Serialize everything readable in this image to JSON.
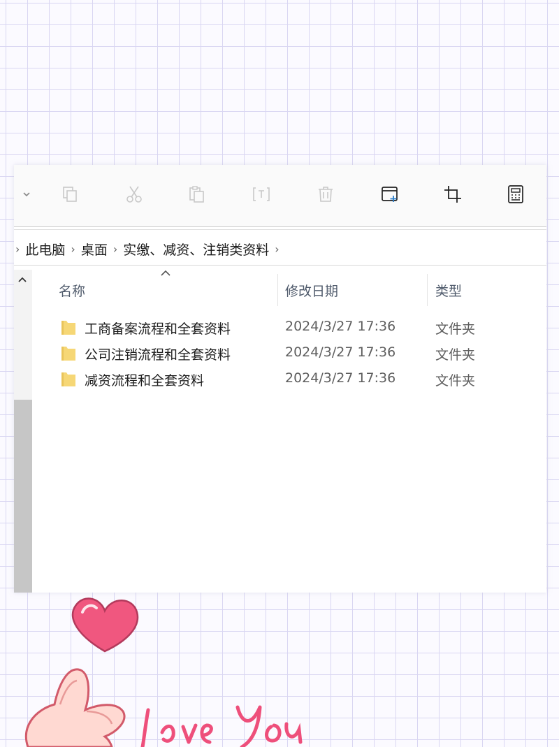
{
  "toolbar": {
    "items": [
      {
        "icon": "chevron-down-icon"
      },
      {
        "icon": "copy-icon"
      },
      {
        "icon": "cut-icon"
      },
      {
        "icon": "paste-icon"
      },
      {
        "icon": "rename-icon"
      },
      {
        "icon": "delete-icon"
      },
      {
        "icon": "new-window-icon"
      },
      {
        "icon": "crop-icon"
      },
      {
        "icon": "calculator-icon"
      }
    ]
  },
  "breadcrumb": {
    "items": [
      "此电脑",
      "桌面",
      "实缴、减资、注销类资料"
    ]
  },
  "columns": {
    "name": "名称",
    "date": "修改日期",
    "type": "类型"
  },
  "files": [
    {
      "name": "工商备案流程和全套资料",
      "date": "2024/3/27 17:36",
      "type": "文件夹"
    },
    {
      "name": "公司注销流程和全套资料",
      "date": "2024/3/27 17:36",
      "type": "文件夹"
    },
    {
      "name": "减资流程和全套资料",
      "date": "2024/3/27 17:36",
      "type": "文件夹"
    }
  ],
  "decoration": {
    "handwriting": "Love You",
    "icons": [
      "heart-icon",
      "finger-heart-hand-icon"
    ]
  },
  "colors": {
    "grid": "#d9d6f2",
    "folder": "#f6d776",
    "heart": "#f0577f",
    "handwriting": "#ee4f7b"
  }
}
